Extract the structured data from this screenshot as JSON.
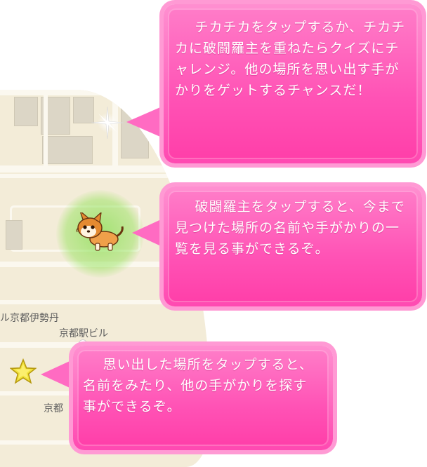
{
  "map": {
    "labels": {
      "isetan": "ル京都伊勢丹",
      "station_building": "京都駅ビル",
      "kyoto_partial": "京都"
    }
  },
  "tips": [
    {
      "text": "チカチカをタップするか、チカチカに破闘羅主を重ねたらクイズにチャレンジ。他の場所を思い出す手がかりをゲットするチャンスだ！"
    },
    {
      "text": "破闘羅主をタップすると、今まで見つけた場所の名前や手がかりの一覧を見る事ができるぞ。"
    },
    {
      "text": "思い出した場所をタップすると、名前をみたり、他の手がかりを探す事ができるぞ。"
    }
  ],
  "colors": {
    "bubble_pink": "#ff52b5",
    "bubble_border": "#ff9ad4",
    "map_bg": "#f3ecd8",
    "glow_green": "#8ae15a",
    "star_yellow": "#f1e23a"
  }
}
